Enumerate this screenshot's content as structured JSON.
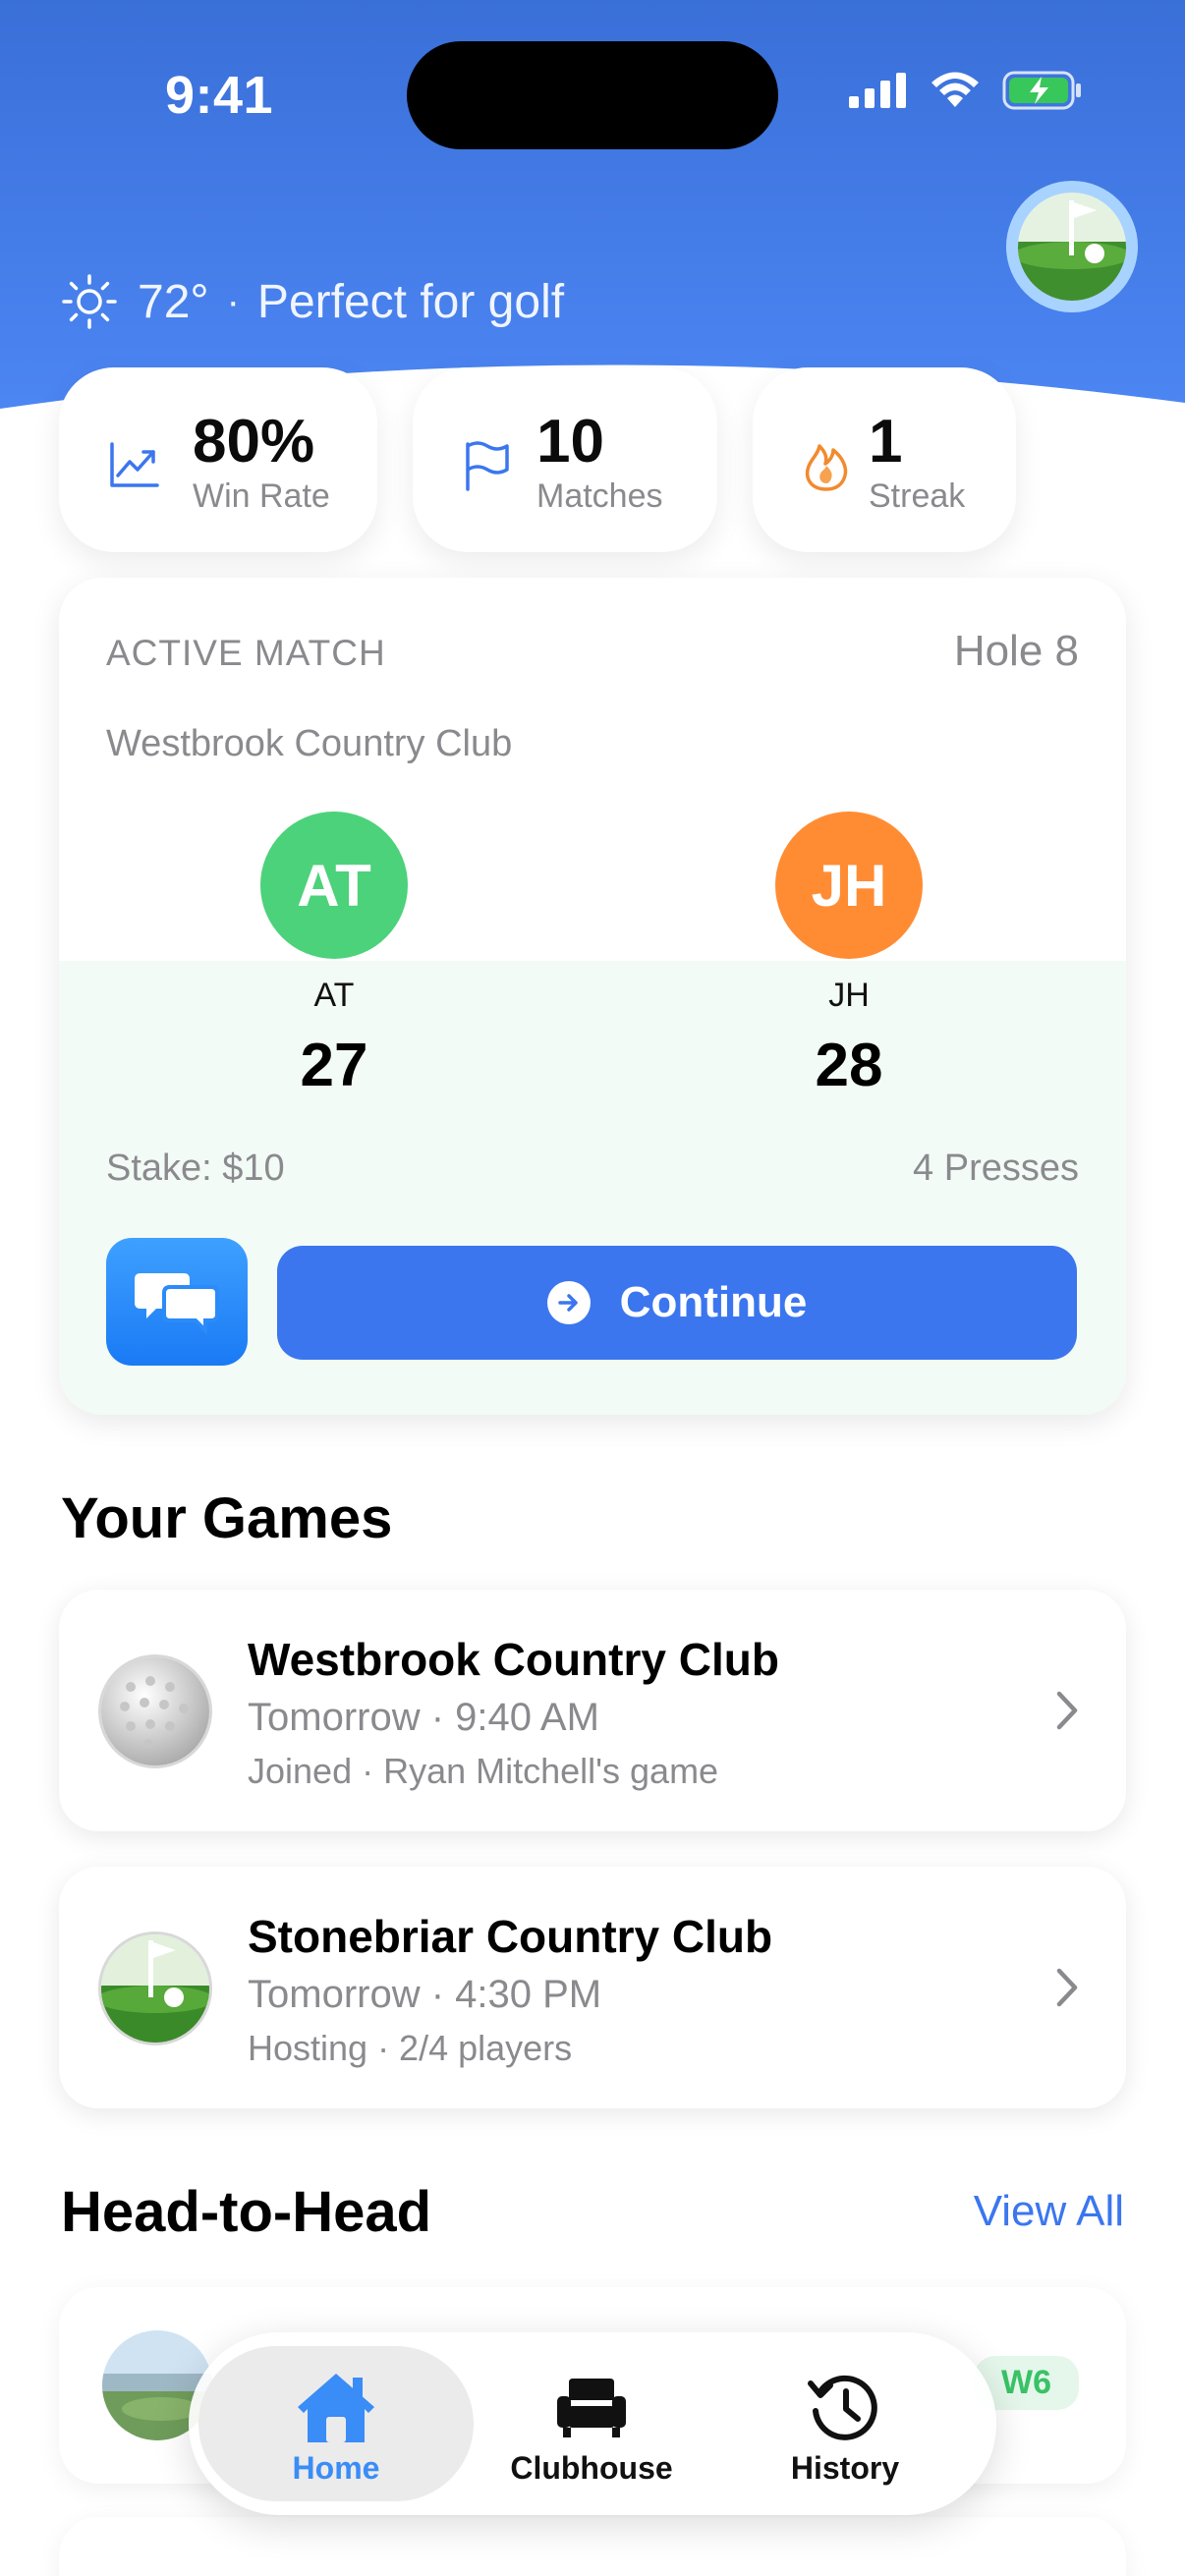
{
  "status_bar": {
    "time": "9:41"
  },
  "weather": {
    "temperature": "72°",
    "separator": "·",
    "description": "Perfect for golf"
  },
  "stats": [
    {
      "value": "80%",
      "label": "Win Rate",
      "icon": "trending-up-icon"
    },
    {
      "value": "10",
      "label": "Matches",
      "icon": "flag-icon"
    },
    {
      "value": "1",
      "label": "Streak",
      "icon": "flame-icon"
    }
  ],
  "active_match": {
    "label": "ACTIVE MATCH",
    "hole": "Hole 8",
    "club": "Westbrook Country Club",
    "players": [
      {
        "initials": "AT",
        "name": "AT",
        "score": "27",
        "color": "#4cd27a"
      },
      {
        "initials": "JH",
        "name": "JH",
        "score": "28",
        "color": "#ff8c33"
      }
    ],
    "stake": "Stake: $10",
    "presses": "4 Presses",
    "continue_label": "Continue"
  },
  "your_games": {
    "title": "Your Games",
    "items": [
      {
        "club": "Westbrook Country Club",
        "when": "Tomorrow · 9:40 AM",
        "meta": "Joined · Ryan Mitchell's game",
        "thumb": "golf-ball"
      },
      {
        "club": "Stonebriar Country Club",
        "when": "Tomorrow · 4:30 PM",
        "meta": "Hosting · 2/4 players",
        "thumb": "golf-green"
      }
    ]
  },
  "head_to_head": {
    "title": "Head-to-Head",
    "view_all": "View All",
    "items": [
      {
        "badge": "W6"
      }
    ]
  },
  "tabbar": {
    "tabs": [
      {
        "label": "Home",
        "icon": "home-icon",
        "active": true
      },
      {
        "label": "Clubhouse",
        "icon": "armchair-icon",
        "active": false
      },
      {
        "label": "History",
        "icon": "history-icon",
        "active": false
      }
    ]
  },
  "colors": {
    "accent": "#3b76ef",
    "win": "#39c266"
  }
}
